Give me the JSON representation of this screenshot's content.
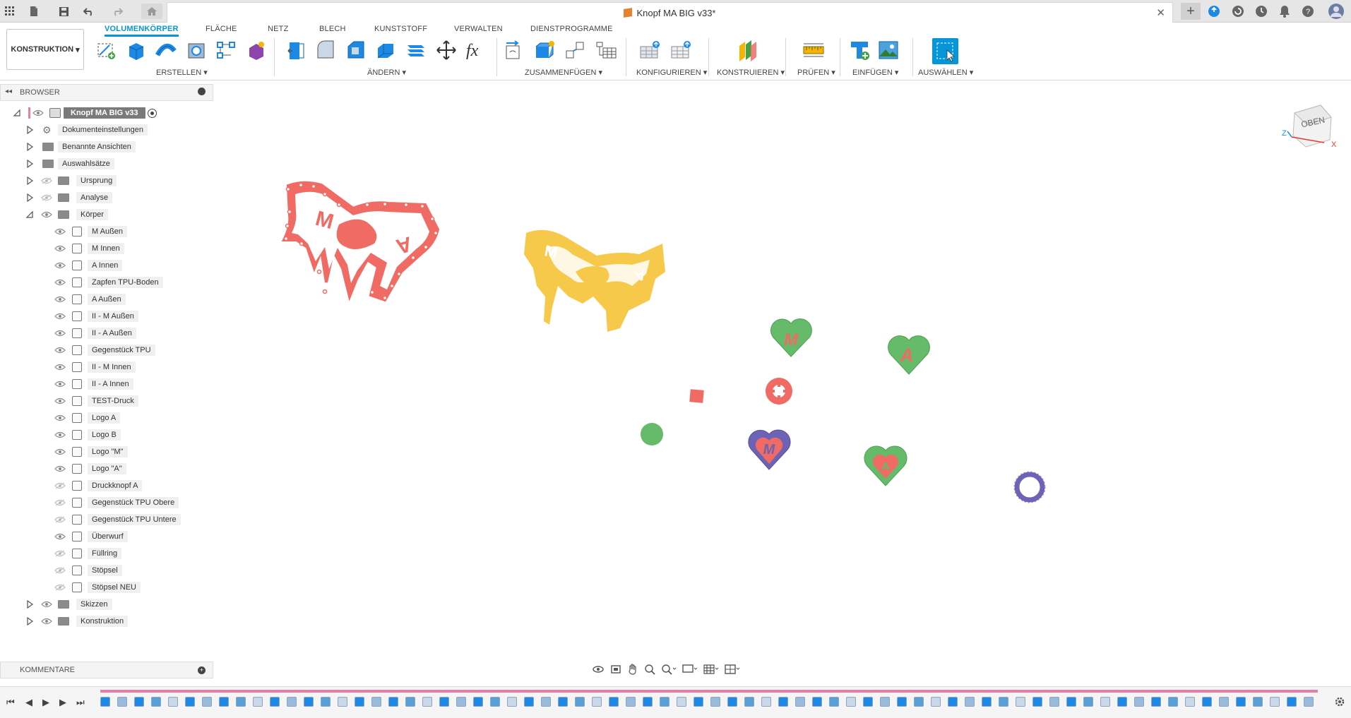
{
  "window": {
    "title": "Knopf MA BIG v33*"
  },
  "ribbon": {
    "workspace": "KONSTRUKTION",
    "tabs": [
      "VOLUMENKÖRPER",
      "FLÄCHE",
      "NETZ",
      "BLECH",
      "KUNSTSTOFF",
      "VERWALTEN",
      "DIENSTPROGRAMME"
    ],
    "groups": [
      "ERSTELLEN",
      "ÄNDERN",
      "ZUSAMMENFÜGEN",
      "KONFIGURIEREN",
      "KONSTRUIEREN",
      "PRÜFEN",
      "EINFÜGEN",
      "AUSWÄHLEN"
    ]
  },
  "browser": {
    "title": "BROWSER",
    "root": "Knopf MA BIG v33",
    "folders": [
      "Dokumenteinstellungen",
      "Benannte Ansichten",
      "Auswahlsätze",
      "Ursprung",
      "Analyse",
      "Körper"
    ],
    "bodies": [
      "M Außen",
      "M Innen",
      "A Innen",
      "Zapfen TPU-Boden",
      "A Außen",
      "II - M Außen",
      "II - A Außen",
      "Gegenstück TPU",
      "II - M Innen",
      "II - A Innen",
      "TEST-Druck",
      "Logo A",
      "Logo B",
      "Logo \"M\"",
      "Logo \"A\"",
      "Druckknopf A",
      "Gegenstück TPU Obere",
      "Gegenstück TPU Untere",
      "Überwurf",
      "Füllring",
      "Stöpsel",
      "Stöpsel NEU"
    ],
    "after": [
      "Skizzen",
      "Konstruktion"
    ]
  },
  "comments": {
    "title": "KOMMENTARE"
  },
  "viewport": {
    "viewcube_label": "OBEN",
    "axis_x": "X",
    "axis_z": "Z",
    "letters": {
      "m": "M",
      "a": "A"
    }
  },
  "colors": {
    "salmon": "#ef6b63",
    "yellow": "#f7c94a",
    "green": "#66bb6a",
    "purple": "#6c63b5",
    "accent": "#0696d7"
  }
}
